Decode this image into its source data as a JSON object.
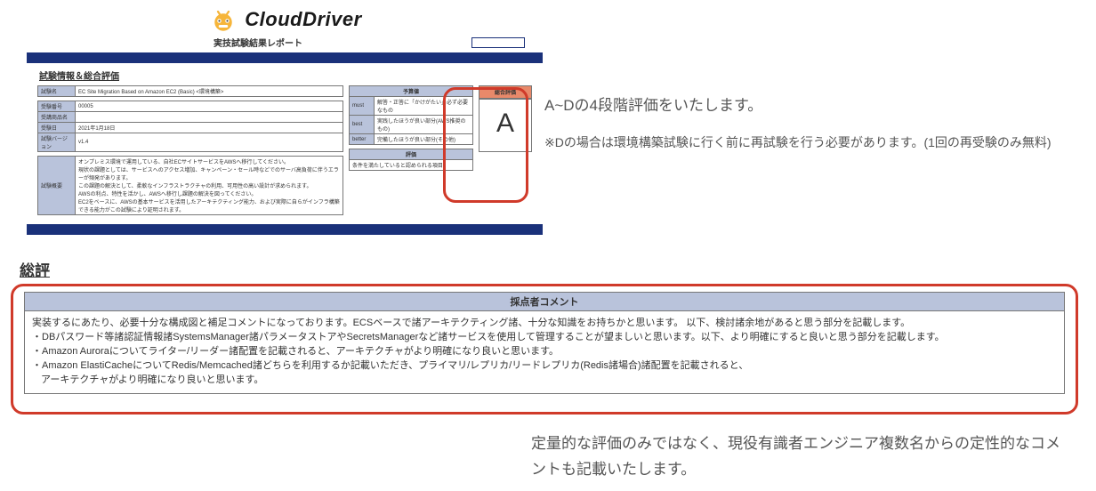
{
  "logo_text": "CloudDriver",
  "subtitle": "実技試験結果レポート",
  "section_info_title": "試験情報＆総合評価",
  "exam": {
    "name_label": "試験名",
    "name_val": "EC Site Migration Based on Amazon EC2 (Basic) <環境構築>",
    "rid_label": "受験番号",
    "rid_val": "00005",
    "pid_label": "受講商品名",
    "pid_val": "",
    "date_label": "受験日",
    "date_val": "2021年1月18日",
    "ver_label": "試験バージョン",
    "ver_val": "v1.4"
  },
  "legend": {
    "header": "予算値",
    "rows": [
      {
        "k": "must",
        "v": "解答・正答に「かけがたい」必ず必要なもの"
      },
      {
        "k": "best",
        "v": "実践したほうが良い部分(AWS推奨のもの)"
      },
      {
        "k": "better",
        "v": "完備したほうが良い部分(その他)"
      }
    ]
  },
  "score": {
    "header": "評価",
    "text": "条件を満たしていると認められる項目"
  },
  "grade": {
    "label": "総合評価",
    "value": "A"
  },
  "overview": {
    "label": "試験概要",
    "text": "オンプレミス環境で運用している、自社ECサイトサービスをAWSへ移行してください。\n現状の課題としては、サービスへのアクセス増加、キャンペーン・セール時などでのサーバ高負荷に伴うエラーが頻発があります。\nこの課題の解決として、柔軟なインフラストラクチャの利用、可用性の高い設計が求められます。\nAWSの利点、特性を活かし、AWSへ移行し課題の解決を図ってください。\nEC2をベースに、AWSの基本サービスを活用したアーキテクティング能力、および実際に自らがインフラ構築できる能力がこの試験により証明されます。"
  },
  "callout_top": {
    "heading": "A~Dの4段階評価をいたします。",
    "sub": "※Dの場合は環境構築試験に行く前に再試験を行う必要があります。(1回の再受験のみ無料)"
  },
  "review": {
    "title": "総評",
    "header": "採点者コメント",
    "lines": [
      "実装するにあたり、必要十分な構成図と補足コメントになっております。ECSベースで諸アーキテクティング諸、十分な知識をお持ちかと思います。 以下、検討諸余地があると思う部分を記載します。",
      "・DBパスワード等諸認証情報諸SystemsManager諸パラメータストアやSecretsManagerなど諸サービスを使用して管理することが望ましいと思います。以下、より明確にすると良いと思う部分を記載します。",
      "・Amazon Auroraについてライター/リーダー諸配置を記載されると、アーキテクチャがより明確になり良いと思います。",
      "・Amazon ElastiCacheについてRedis/Memcached諸どちらを利用するか記載いただき、プライマリ/レプリカ/リードレプリカ(Redis諸場合)諸配置を記載されると、",
      "  アーキテクチャがより明確になり良いと思います。"
    ]
  },
  "callout_bottom": "定量的な評価のみではなく、現役有識者エンジニア複数名からの定性的なコメントも記載いたします。"
}
